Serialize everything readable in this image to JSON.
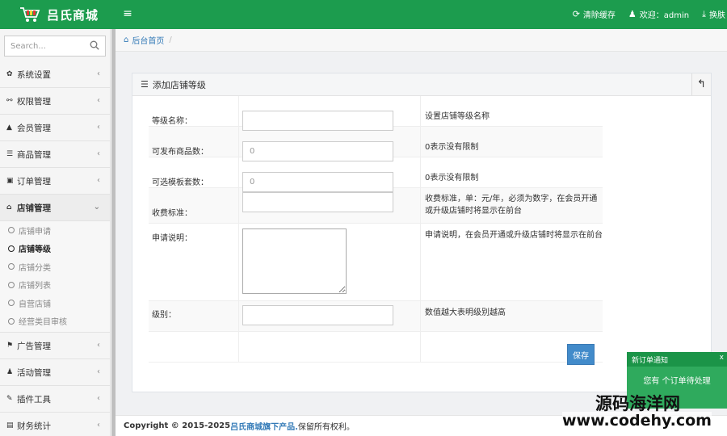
{
  "header": {
    "brand": "吕氏商城",
    "menu_toggle": "≡",
    "clear_cache": "清除缓存",
    "welcome": "欢迎：admin",
    "switch": "换肤"
  },
  "sidebar": {
    "search_placeholder": "Search...",
    "items_top": [
      {
        "icon": "✿",
        "label": "系统设置"
      },
      {
        "icon": "⚯",
        "label": "权限管理"
      },
      {
        "icon": "▲",
        "label": "会员管理"
      },
      {
        "icon": "☰",
        "label": "商品管理"
      },
      {
        "icon": "▣",
        "label": "订单管理"
      }
    ],
    "active": {
      "icon": "⌂",
      "label": "店铺管理"
    },
    "sub_items": [
      "店铺申请",
      "店铺等级",
      "店铺分类",
      "店铺列表",
      "自营店铺",
      "经营类目审核"
    ],
    "items_bottom": [
      {
        "icon": "⚑",
        "label": "广告管理"
      },
      {
        "icon": "♟",
        "label": "活动管理"
      },
      {
        "icon": "✎",
        "label": "插件工具"
      },
      {
        "icon": "▤",
        "label": "财务统计"
      }
    ]
  },
  "breadcrumb": {
    "home": "后台首页",
    "sep": "/"
  },
  "panel": {
    "title": "添加店铺等级",
    "rows": [
      {
        "label": "等级名称：",
        "value": "",
        "hint": "设置店铺等级名称"
      },
      {
        "label": "可发布商品数：",
        "value": "0",
        "hint": "0表示没有限制"
      },
      {
        "label": "可选模板套数：",
        "value": "0",
        "hint": "0表示没有限制"
      },
      {
        "label": "收费标准：",
        "value": "",
        "hint": "收费标准，单：元/年，必须为数字，在会员开通或升级店铺时将显示在前台"
      },
      {
        "label": "申请说明：",
        "value": "",
        "hint": "申请说明，在会员开通或升级店铺时将显示在前台"
      },
      {
        "label": "级别：",
        "value": "",
        "hint": "数值越大表明级别越高"
      }
    ],
    "save": "保存"
  },
  "footer": {
    "prefix": "Copyright © 2015-2025 ",
    "link": "吕氏商城旗下产品.",
    "suffix": "保留所有权利。"
  },
  "notify": {
    "title": "新订单通知",
    "close": "x",
    "body": "您有 个订单待处理"
  },
  "watermark": {
    "line1": "源码海洋网",
    "line2": "www.codehy.com"
  }
}
